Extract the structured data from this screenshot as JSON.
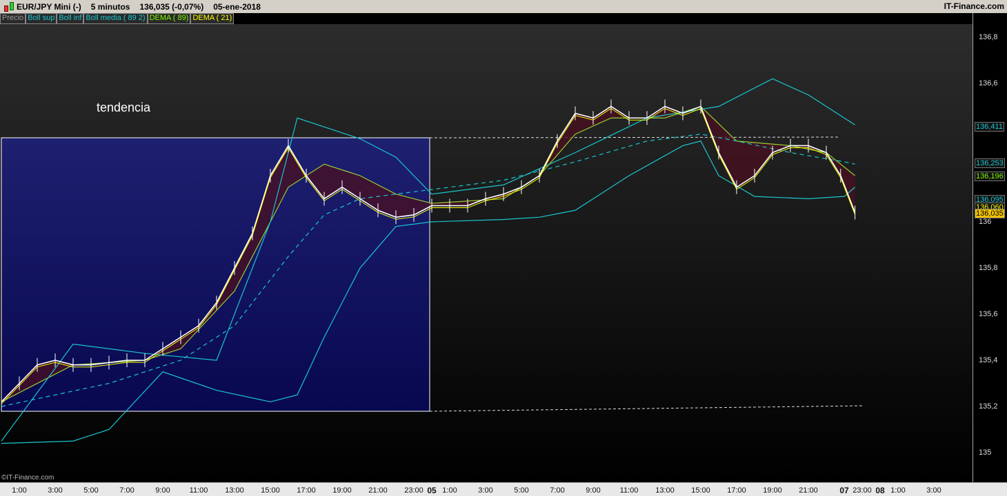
{
  "title": {
    "symbol": "EUR/JPY Mini (-)",
    "interval": "5 minutos",
    "price": "136,035 (-0,07%)",
    "date": "05-ene-2018",
    "brand": "IT-Finance.com"
  },
  "legend": [
    {
      "label": "Precio",
      "color": "#9a9a9a"
    },
    {
      "label": "Boll sup",
      "color": "#19c8d0"
    },
    {
      "label": "Boll inf",
      "color": "#19c8d0"
    },
    {
      "label": "Boll media ( 89 2)",
      "color": "#19c8d0"
    },
    {
      "label": "DEMA ( 89)",
      "color": "#7cfc00"
    },
    {
      "label": "DEMA ( 21)",
      "color": "#ffff00"
    }
  ],
  "annotation": "tendencia",
  "copyright": "©IT-Finance.com",
  "price_tags": [
    {
      "label": "136,411",
      "value": 136.411,
      "color": "#19c8d0"
    },
    {
      "label": "136,253",
      "value": 136.253,
      "color": "#19c8d0"
    },
    {
      "label": "136,196",
      "value": 136.196,
      "color": "#7cfc00"
    },
    {
      "label": "136,095",
      "value": 136.095,
      "color": "#19c8d0"
    },
    {
      "label": "136,060",
      "value": 136.06,
      "color": "#ffff00"
    },
    {
      "label": "136,035",
      "value": 136.035,
      "color": "#000000",
      "bg": "#f0c000"
    }
  ],
  "chart_data": {
    "type": "line",
    "ylim": [
      134.85,
      136.9
    ],
    "y_ticks": [
      {
        "v": 135,
        "label": "135"
      },
      {
        "v": 135.2,
        "label": "135,2"
      },
      {
        "v": 135.4,
        "label": "135,4"
      },
      {
        "v": 135.6,
        "label": "135,6"
      },
      {
        "v": 135.8,
        "label": "135,8"
      },
      {
        "v": 136,
        "label": "136"
      },
      {
        "v": 136.6,
        "label": "136,6"
      },
      {
        "v": 136.8,
        "label": "136,8"
      }
    ],
    "x_ticks": [
      {
        "h": 1,
        "label": "1:00"
      },
      {
        "h": 3,
        "label": "3:00"
      },
      {
        "h": 5,
        "label": "5:00"
      },
      {
        "h": 7,
        "label": "7:00"
      },
      {
        "h": 9,
        "label": "9:00"
      },
      {
        "h": 11,
        "label": "11:00"
      },
      {
        "h": 13,
        "label": "13:00"
      },
      {
        "h": 15,
        "label": "15:00"
      },
      {
        "h": 17,
        "label": "17:00"
      },
      {
        "h": 19,
        "label": "19:00"
      },
      {
        "h": 21,
        "label": "21:00"
      },
      {
        "h": 23,
        "label": "23:00"
      },
      {
        "h": 24,
        "label": "05",
        "bold": true
      },
      {
        "h": 25,
        "label": "1:00"
      },
      {
        "h": 27,
        "label": "3:00"
      },
      {
        "h": 29,
        "label": "5:00"
      },
      {
        "h": 31,
        "label": "7:00"
      },
      {
        "h": 33,
        "label": "9:00"
      },
      {
        "h": 35,
        "label": "11:00"
      },
      {
        "h": 37,
        "label": "13:00"
      },
      {
        "h": 39,
        "label": "15:00"
      },
      {
        "h": 41,
        "label": "17:00"
      },
      {
        "h": 43,
        "label": "19:00"
      },
      {
        "h": 45,
        "label": "21:00"
      },
      {
        "h": 47,
        "label": "07",
        "bold": true
      },
      {
        "h": 48,
        "label": "23:00"
      },
      {
        "h": 49,
        "label": "08",
        "bold": true
      },
      {
        "h": 50,
        "label": "1:00"
      },
      {
        "h": 52,
        "label": "3:00"
      }
    ],
    "series": [
      {
        "name": "Precio",
        "color": "#ffffff",
        "points": [
          [
            0,
            135.22
          ],
          [
            1,
            135.3
          ],
          [
            2,
            135.38
          ],
          [
            3,
            135.4
          ],
          [
            4,
            135.38
          ],
          [
            5,
            135.38
          ],
          [
            6,
            135.39
          ],
          [
            7,
            135.4
          ],
          [
            8,
            135.4
          ],
          [
            9,
            135.45
          ],
          [
            10,
            135.5
          ],
          [
            11,
            135.55
          ],
          [
            12,
            135.65
          ],
          [
            13,
            135.8
          ],
          [
            14,
            135.95
          ],
          [
            15,
            136.2
          ],
          [
            16,
            136.33
          ],
          [
            17,
            136.2
          ],
          [
            18,
            136.1
          ],
          [
            19,
            136.15
          ],
          [
            20,
            136.1
          ],
          [
            21,
            136.05
          ],
          [
            22,
            136.02
          ],
          [
            23,
            136.03
          ],
          [
            24,
            136.07
          ],
          [
            25,
            136.07
          ],
          [
            26,
            136.07
          ],
          [
            27,
            136.1
          ],
          [
            28,
            136.12
          ],
          [
            29,
            136.15
          ],
          [
            30,
            136.2
          ],
          [
            31,
            136.35
          ],
          [
            32,
            136.47
          ],
          [
            33,
            136.45
          ],
          [
            34,
            136.5
          ],
          [
            35,
            136.45
          ],
          [
            36,
            136.45
          ],
          [
            37,
            136.5
          ],
          [
            38,
            136.47
          ],
          [
            39,
            136.5
          ],
          [
            40,
            136.3
          ],
          [
            41,
            136.15
          ],
          [
            42,
            136.2
          ],
          [
            43,
            136.3
          ],
          [
            44,
            136.33
          ],
          [
            45,
            136.33
          ],
          [
            46,
            136.3
          ],
          [
            46.8,
            136.2
          ],
          [
            47.6,
            136.04
          ]
        ]
      },
      {
        "name": "Boll sup",
        "color": "#19c8d0",
        "points": [
          [
            0,
            135.05
          ],
          [
            4,
            135.47
          ],
          [
            8,
            135.43
          ],
          [
            12,
            135.4
          ],
          [
            15,
            136.0
          ],
          [
            16.5,
            136.45
          ],
          [
            20,
            136.36
          ],
          [
            22,
            136.28
          ],
          [
            24,
            136.12
          ],
          [
            28,
            136.16
          ],
          [
            32,
            136.3
          ],
          [
            36,
            136.45
          ],
          [
            40,
            136.5
          ],
          [
            43,
            136.62
          ],
          [
            45,
            136.55
          ],
          [
            47,
            136.45
          ],
          [
            47.6,
            136.42
          ]
        ]
      },
      {
        "name": "Boll inf",
        "color": "#19c8d0",
        "points": [
          [
            0,
            135.04
          ],
          [
            4,
            135.05
          ],
          [
            6,
            135.1
          ],
          [
            9,
            135.35
          ],
          [
            12,
            135.27
          ],
          [
            15,
            135.22
          ],
          [
            16.5,
            135.25
          ],
          [
            18,
            135.5
          ],
          [
            20,
            135.8
          ],
          [
            22,
            135.98
          ],
          [
            24,
            136.0
          ],
          [
            28,
            136.01
          ],
          [
            30,
            136.02
          ],
          [
            32,
            136.05
          ],
          [
            35,
            136.2
          ],
          [
            38,
            136.33
          ],
          [
            39,
            136.35
          ],
          [
            40,
            136.2
          ],
          [
            42,
            136.11
          ],
          [
            45,
            136.1
          ],
          [
            47,
            136.11
          ],
          [
            47.6,
            136.15
          ]
        ]
      },
      {
        "name": "Boll media",
        "color": "#19c8d0",
        "dashed": true,
        "points": [
          [
            0,
            135.2
          ],
          [
            6,
            135.3
          ],
          [
            10,
            135.4
          ],
          [
            13,
            135.55
          ],
          [
            16,
            135.85
          ],
          [
            18,
            136.03
          ],
          [
            20,
            136.1
          ],
          [
            24,
            136.14
          ],
          [
            28,
            136.18
          ],
          [
            32,
            136.26
          ],
          [
            36,
            136.35
          ],
          [
            39,
            136.38
          ],
          [
            41,
            136.35
          ],
          [
            44,
            136.3
          ],
          [
            47,
            136.26
          ],
          [
            47.6,
            136.25
          ]
        ]
      },
      {
        "name": "DEMA 89",
        "color": "#9acd32",
        "points": [
          [
            0,
            135.22
          ],
          [
            4,
            135.38
          ],
          [
            8,
            135.4
          ],
          [
            10,
            135.45
          ],
          [
            13,
            135.7
          ],
          [
            16,
            136.15
          ],
          [
            18,
            136.25
          ],
          [
            20,
            136.2
          ],
          [
            22,
            136.12
          ],
          [
            24,
            136.08
          ],
          [
            28,
            136.1
          ],
          [
            30,
            136.2
          ],
          [
            32,
            136.38
          ],
          [
            34,
            136.45
          ],
          [
            37,
            136.45
          ],
          [
            39,
            136.5
          ],
          [
            41,
            136.35
          ],
          [
            44,
            136.33
          ],
          [
            46,
            136.3
          ],
          [
            47.6,
            136.2
          ]
        ]
      }
    ]
  }
}
